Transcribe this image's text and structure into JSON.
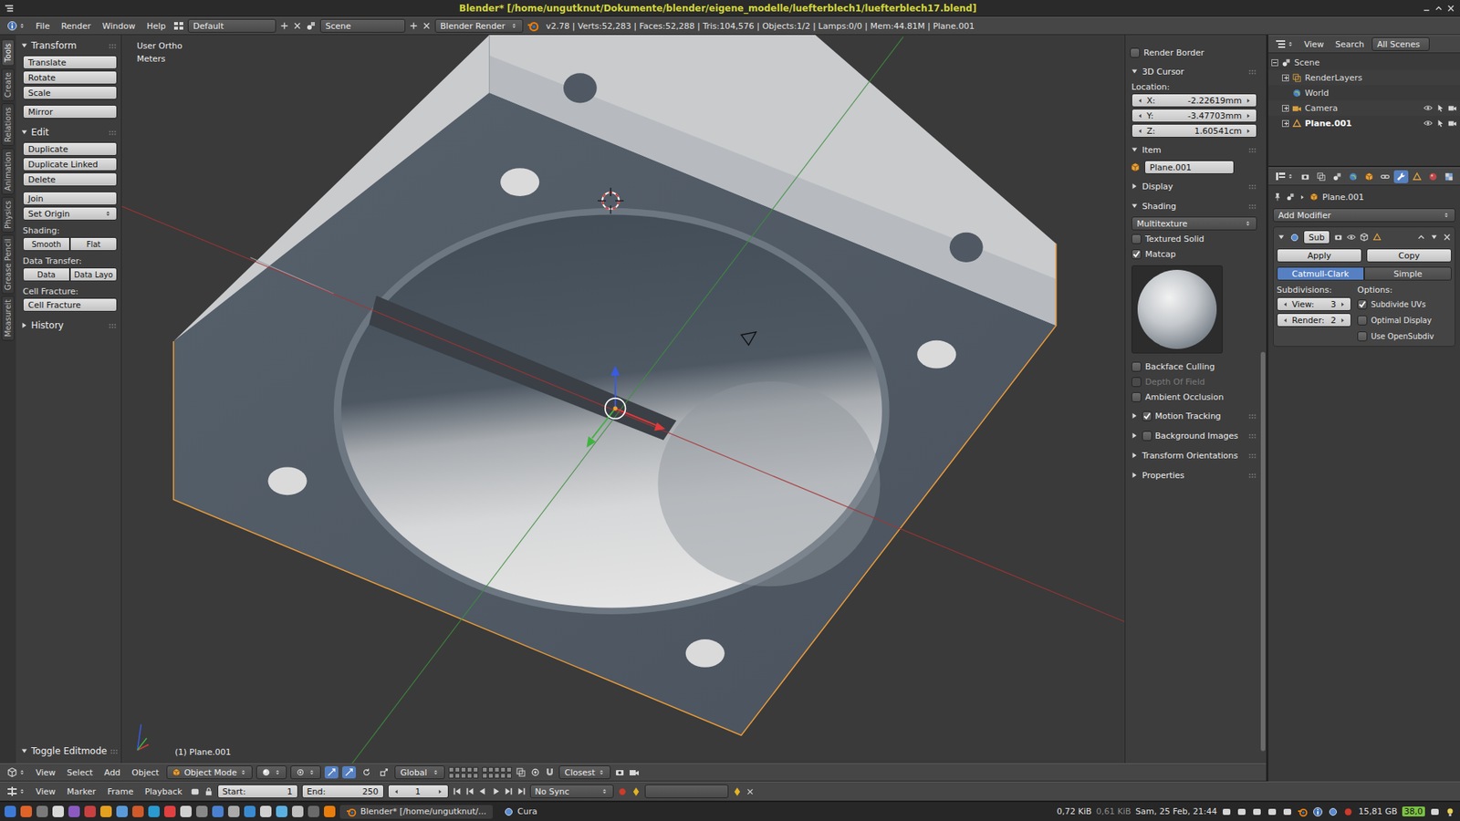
{
  "window": {
    "title": "Blender* [/home/ungutknut/Dokumente/blender/eigene_modelle/luefterblech1/luefterblech17.blend]"
  },
  "info_header": {
    "menus": [
      "File",
      "Render",
      "Window",
      "Help"
    ],
    "layout": "Default",
    "scene": "Scene",
    "engine": "Blender Render",
    "stats": "v2.78 | Verts:52,283 | Faces:52,288 | Tris:104,576 | Objects:1/2 | Lamps:0/0 | Mem:44.81M | Plane.001"
  },
  "tool_tabs": [
    {
      "label": "Tools",
      "selected": true
    },
    {
      "label": "Create",
      "selected": false
    },
    {
      "label": "Relations",
      "selected": false
    },
    {
      "label": "Animation",
      "selected": false
    },
    {
      "label": "Physics",
      "selected": false
    },
    {
      "label": "Grease Pencil",
      "selected": false
    },
    {
      "label": "Measureit",
      "selected": false
    }
  ],
  "tool_shelf": {
    "panels": [
      {
        "title": "Transform",
        "expanded": true,
        "groups": [
          [
            {
              "kind": "button",
              "label": "Translate"
            },
            {
              "kind": "button",
              "label": "Rotate"
            },
            {
              "kind": "button",
              "label": "Scale"
            }
          ],
          [
            {
              "kind": "button",
              "label": "Mirror"
            }
          ]
        ]
      },
      {
        "title": "Edit",
        "expanded": true,
        "groups": [
          [
            {
              "kind": "button",
              "label": "Duplicate"
            },
            {
              "kind": "button",
              "label": "Duplicate Linked"
            },
            {
              "kind": "button",
              "label": "Delete"
            }
          ],
          [
            {
              "kind": "button",
              "label": "Join"
            },
            {
              "kind": "dropdown",
              "label": "Set Origin"
            }
          ],
          [
            {
              "kind": "label",
              "label": "Shading:"
            },
            {
              "kind": "pair",
              "labels": [
                "Smooth",
                "Flat"
              ]
            }
          ],
          [
            {
              "kind": "label",
              "label": "Data Transfer:"
            },
            {
              "kind": "pair",
              "labels": [
                "Data",
                "Data Layo"
              ]
            }
          ],
          [
            {
              "kind": "label",
              "label": "Cell Fracture:"
            },
            {
              "kind": "button",
              "label": "Cell Fracture"
            }
          ]
        ]
      },
      {
        "title": "History",
        "expanded": false,
        "groups": []
      }
    ],
    "operator_panel": {
      "title": "Toggle Editmode",
      "expanded": true
    }
  },
  "viewport": {
    "view_name": "User Ortho",
    "units": "Meters",
    "object_label": "(1) Plane.001"
  },
  "n_panel": {
    "render_border": {
      "label": "Render Border",
      "checked": false
    },
    "cursor": {
      "title": "3D Cursor",
      "expanded": true,
      "location_label": "Location:",
      "fields": [
        {
          "axis": "X:",
          "value": "-2.22619mm"
        },
        {
          "axis": "Y:",
          "value": "-3.47703mm"
        },
        {
          "axis": "Z:",
          "value": "1.60541cm"
        }
      ]
    },
    "item": {
      "title": "Item",
      "expanded": true,
      "name": "Plane.001"
    },
    "display": {
      "title": "Display",
      "expanded": false
    },
    "shading": {
      "title": "Shading",
      "expanded": true,
      "texture_mode": "Multitexture",
      "toggles": [
        {
          "label": "Textured Solid",
          "checked": false,
          "disabled": false
        },
        {
          "label": "Matcap",
          "checked": true,
          "disabled": false
        }
      ],
      "options": [
        {
          "label": "Backface Culling",
          "checked": false,
          "disabled": false
        },
        {
          "label": "Depth Of Field",
          "checked": false,
          "disabled": true
        },
        {
          "label": "Ambient Occlusion",
          "checked": false,
          "disabled": false
        }
      ]
    },
    "more_panels": [
      {
        "title": "Motion Tracking",
        "kind": "checkbox",
        "checked": true,
        "expanded": false
      },
      {
        "title": "Background Images",
        "kind": "checkbox",
        "checked": false,
        "expanded": false
      },
      {
        "title": "Transform Orientations",
        "kind": "plain",
        "expanded": false
      },
      {
        "title": "Properties",
        "kind": "plain",
        "expanded": false
      }
    ],
    "scrollbar": {
      "level": 0.56
    }
  },
  "outliner": {
    "menus": [
      "View",
      "Search"
    ],
    "filter": "All Scenes",
    "tree": [
      {
        "label": "Scene",
        "kind": "scene",
        "depth": 0,
        "expandable": true,
        "expanded": true,
        "selected": false
      },
      {
        "label": "RenderLayers",
        "kind": "layers",
        "depth": 1,
        "expandable": true,
        "expanded": false,
        "selected": false
      },
      {
        "label": "World",
        "kind": "world",
        "depth": 1,
        "expandable": false,
        "expanded": false,
        "selected": false
      },
      {
        "label": "Camera",
        "kind": "camera",
        "depth": 1,
        "expandable": true,
        "expanded": false,
        "selected": false
      },
      {
        "label": "Plane.001",
        "kind": "mesh",
        "depth": 1,
        "expandable": true,
        "expanded": false,
        "selected": true
      }
    ]
  },
  "properties": {
    "context_tabs": [
      {
        "selected": false
      },
      {
        "selected": false
      },
      {
        "selected": false
      },
      {
        "selected": false
      },
      {
        "selected": false
      },
      {
        "selected": false
      },
      {
        "selected": true
      },
      {
        "selected": false
      },
      {
        "selected": false
      },
      {
        "selected": false
      }
    ],
    "breadcrumb": "Plane.001",
    "add_modifier": "Add Modifier",
    "modifier": {
      "name": "Sub",
      "expanded": true,
      "actions": [
        "Apply",
        "Copy"
      ],
      "modes": [
        {
          "label": "Catmull-Clark",
          "selected": true
        },
        {
          "label": "Simple",
          "selected": false
        }
      ],
      "subdivisions_label": "Subdivisions:",
      "options_label": "Options:",
      "levels": [
        {
          "label": "View:",
          "value": "3"
        },
        {
          "label": "Render:",
          "value": "2"
        }
      ],
      "options": [
        {
          "label": "Subdivide UVs",
          "checked": true
        },
        {
          "label": "Optimal Display",
          "checked": false
        },
        {
          "label": "Use OpenSubdiv",
          "checked": false
        }
      ]
    }
  },
  "view_header": {
    "menus": [
      "View",
      "Select",
      "Add",
      "Object"
    ],
    "mode": "Object Mode",
    "orientation": "Global",
    "snap_element": "Closest"
  },
  "timeline": {
    "menus": [
      "View",
      "Marker",
      "Frame",
      "Playback"
    ],
    "start": {
      "label": "Start:",
      "value": "1"
    },
    "end": {
      "label": "End:",
      "value": "250"
    },
    "current_frame": "1",
    "sync": "No Sync"
  },
  "taskbar": {
    "tasks": [
      {
        "label": "Blender* [/home/ungutknut/...",
        "selected": true
      },
      {
        "label": "Cura",
        "selected": false
      }
    ],
    "net_down": "0,72 KiB",
    "net_up": "0,61 KiB",
    "clock": "Sam, 25 Feb, 21:44",
    "disk": "15,81 GB",
    "temperature": "38,0"
  }
}
